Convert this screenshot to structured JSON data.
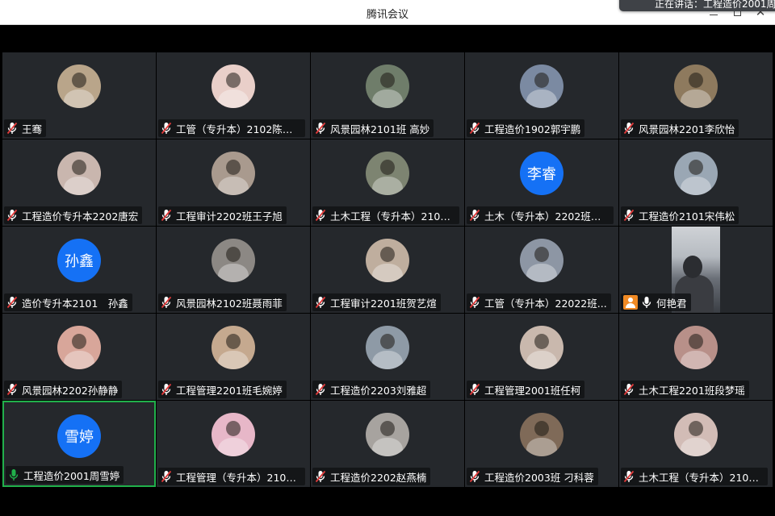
{
  "window": {
    "title": "腾讯会议",
    "notice": "正在讲话：工程造价2001周雪婷"
  },
  "colors": {
    "background": "#000000",
    "tile": "#25282c",
    "avatar_blue": "#1571f5",
    "speaking_border": "#21b04b",
    "mic_muted": "#e23b3b",
    "mic_active": "#21b04b",
    "host_badge": "#f08a24"
  },
  "participants": [
    {
      "name": "王骞",
      "mic": "muted",
      "avatar": "photo",
      "tint": "#b9a58a"
    },
    {
      "name": "工管（专升本）2102陈佳...",
      "mic": "muted",
      "avatar": "photo",
      "tint": "#e9cfc9"
    },
    {
      "name": "风景园林2101班 高妙",
      "mic": "muted",
      "avatar": "photo",
      "tint": "#6f7d6a"
    },
    {
      "name": "工程造价1902郭宇鹏",
      "mic": "muted",
      "avatar": "photo",
      "tint": "#7b8aa2"
    },
    {
      "name": "风景园林2201李欣怡",
      "mic": "muted",
      "avatar": "photo",
      "tint": "#8e7a5e"
    },
    {
      "name": "工程造价专升本2202唐宏",
      "mic": "muted",
      "avatar": "photo",
      "tint": "#c9b6ae"
    },
    {
      "name": "工程审计2202班王子旭",
      "mic": "muted",
      "avatar": "photo",
      "tint": "#a99a8e"
    },
    {
      "name": "土木工程（专升本）2101...",
      "mic": "muted",
      "avatar": "photo",
      "tint": "#7d8471"
    },
    {
      "name": "土木（专升本）2202班李...",
      "mic": "muted",
      "avatar": "text",
      "avatar_text": "李睿"
    },
    {
      "name": "工程造价2101宋伟松",
      "mic": "muted",
      "avatar": "photo",
      "tint": "#9aa7b4"
    },
    {
      "name": "造价专升本2101　孙鑫",
      "mic": "muted",
      "avatar": "text",
      "avatar_text": "孙鑫"
    },
    {
      "name": "风景园林2102班聂雨菲",
      "mic": "muted",
      "avatar": "photo",
      "tint": "#8c8884"
    },
    {
      "name": "工程审计2201班贺艺煊",
      "mic": "muted",
      "avatar": "photo",
      "tint": "#bfae9e"
    },
    {
      "name": "工管（专升本）22022班...",
      "mic": "muted",
      "avatar": "photo",
      "tint": "#8d96a4"
    },
    {
      "name": "何艳君",
      "mic": "open",
      "avatar": "video",
      "host": true
    },
    {
      "name": "风景园林2202孙静静",
      "mic": "muted",
      "avatar": "photo",
      "tint": "#d8a69a"
    },
    {
      "name": "工程管理2201班毛婉婷",
      "mic": "muted",
      "avatar": "photo",
      "tint": "#c5a98f"
    },
    {
      "name": "工程造价2203刘雅超",
      "mic": "muted",
      "avatar": "photo",
      "tint": "#8e9aa6"
    },
    {
      "name": "工程管理2001班任柯",
      "mic": "muted",
      "avatar": "photo",
      "tint": "#c9b8ad"
    },
    {
      "name": "土木工程2201班段梦瑶",
      "mic": "muted",
      "avatar": "photo",
      "tint": "#b89089"
    },
    {
      "name": "工程造价2001周雪婷",
      "mic": "active",
      "avatar": "text",
      "avatar_text": "雪婷",
      "speaking": true
    },
    {
      "name": "工程管理（专升本）2101...",
      "mic": "muted",
      "avatar": "photo",
      "tint": "#e7b7c8"
    },
    {
      "name": "工程造价2202赵燕楠",
      "mic": "muted",
      "avatar": "photo",
      "tint": "#a7a39f"
    },
    {
      "name": "工程造价2003班 刁科蓉",
      "mic": "muted",
      "avatar": "photo",
      "tint": "#7f6a58"
    },
    {
      "name": "土木工程（专升本）2102...",
      "mic": "muted",
      "avatar": "photo",
      "tint": "#d2bcb6"
    }
  ]
}
